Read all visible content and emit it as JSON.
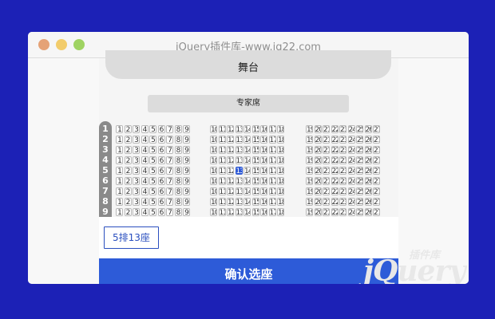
{
  "window": {
    "title": "jQuery插件库-www.jq22.com"
  },
  "cinema": {
    "stage_label": "舞台",
    "vip_label": "专家席",
    "rows": [
      "1",
      "2",
      "3",
      "4",
      "5",
      "6",
      "7",
      "8",
      "9"
    ],
    "seat_numbers": [
      "1",
      "2",
      "3",
      "4",
      "5",
      "6",
      "7",
      "8",
      "9",
      "10",
      "11",
      "12",
      "13",
      "14",
      "15",
      "16",
      "17",
      "18",
      "19",
      "20",
      "21",
      "22",
      "23",
      "24",
      "25",
      "26",
      "27"
    ],
    "selected_seat": {
      "row": 5,
      "seat": 13,
      "label": "5排13座"
    },
    "confirm_label": "确认选座"
  },
  "watermark": {
    "small": "插件库",
    "big": "jQuery"
  },
  "colors": {
    "background": "#1c21b6",
    "accent": "#2d5bd8",
    "stage": "#dcdcdc"
  }
}
